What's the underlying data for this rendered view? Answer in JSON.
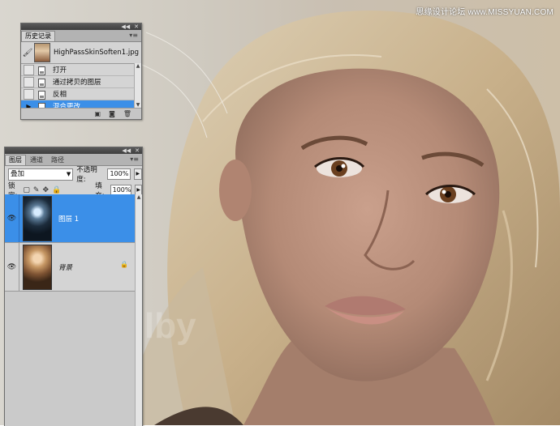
{
  "watermark": "思缘设计论坛 www.MISSYUAN.COM",
  "canvas_overlay_text": "lby",
  "history_panel": {
    "title_tab": "历史记录",
    "snapshot_name": "HighPassSkinSoften1.jpg",
    "items": [
      {
        "label": "打开",
        "selected": false
      },
      {
        "label": "通过拷贝的图层",
        "selected": false
      },
      {
        "label": "反相",
        "selected": false
      },
      {
        "label": "混合更改",
        "selected": true
      }
    ]
  },
  "layers_panel": {
    "tabs": [
      "图层",
      "通道",
      "路径"
    ],
    "active_tab": "图层",
    "blend_mode": "叠加",
    "opacity_label": "不透明度:",
    "opacity_value": "100%",
    "lock_label": "锁定:",
    "fill_label": "填充:",
    "fill_value": "100%",
    "layers": [
      {
        "name": "图层 1",
        "selected": true
      },
      {
        "name": "背景",
        "selected": false
      }
    ]
  },
  "colors": {
    "selection_blue": "#3b8fe8",
    "panel_bg": "#d4d4d4",
    "titlebar": "#474747"
  },
  "icons": [
    "history-brush-icon",
    "document-state-icon",
    "new-document-icon",
    "snapshot-icon",
    "trash-icon",
    "eye-icon",
    "lock-icon",
    "panel-menu-icon"
  ]
}
